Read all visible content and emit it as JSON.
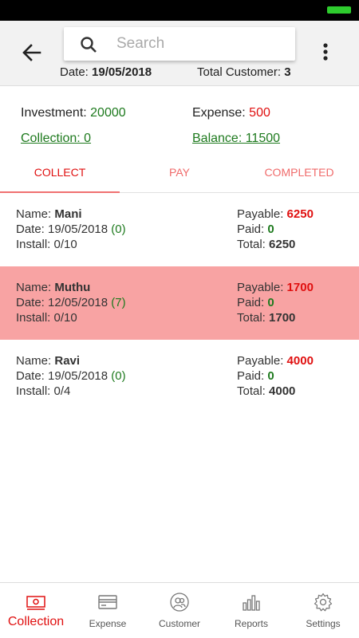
{
  "header": {
    "search_placeholder": "Search",
    "date_label": "Date:",
    "date_value": "19/05/2018",
    "total_label": "Total Customer:",
    "total_value": "3"
  },
  "summary": {
    "investment_label": "Investment:",
    "investment_value": "20000",
    "expense_label": "Expense:",
    "expense_value": "500",
    "collection_link": "Collection: 0",
    "balance_link": "Balance: 11500"
  },
  "tabs": [
    {
      "label": "COLLECT",
      "active": true
    },
    {
      "label": "PAY",
      "active": false
    },
    {
      "label": "COMPLETED",
      "active": false
    }
  ],
  "customers": [
    {
      "name": "Mani",
      "date": "19/05/2018",
      "days": "(0)",
      "install": "0/10",
      "payable": "6250",
      "paid": "0",
      "total": "6250"
    },
    {
      "name": "Muthu",
      "date": "12/05/2018",
      "days": "(7)",
      "install": "0/10",
      "payable": "1700",
      "paid": "0",
      "total": "1700"
    },
    {
      "name": "Ravi",
      "date": "19/05/2018",
      "days": "(0)",
      "install": "0/4",
      "payable": "4000",
      "paid": "0",
      "total": "4000"
    }
  ],
  "row_labels": {
    "name": "Name:",
    "date": "Date:",
    "install": "Install:",
    "payable": "Payable:",
    "paid": "Paid:",
    "total": "Total:"
  },
  "nav": [
    {
      "label": "Collection",
      "icon": "money-icon"
    },
    {
      "label": "Expense",
      "icon": "card-icon"
    },
    {
      "label": "Customer",
      "icon": "customer-icon"
    },
    {
      "label": "Reports",
      "icon": "bar-chart-icon"
    },
    {
      "label": "Settings",
      "icon": "gear-icon"
    }
  ],
  "colors": {
    "accent_red": "#e01010",
    "green": "#1e7a1e",
    "highlight_row": "#f8a3a3"
  }
}
